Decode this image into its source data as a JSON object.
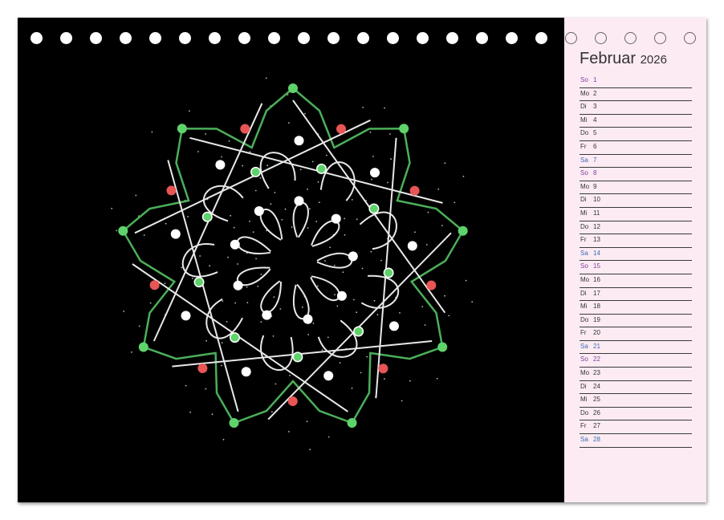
{
  "calendar": {
    "month": "Februar",
    "year": "2026",
    "days": [
      {
        "wd": "So",
        "d": "1",
        "type": "sun"
      },
      {
        "wd": "Mo",
        "d": "2",
        "type": "week"
      },
      {
        "wd": "Di",
        "d": "3",
        "type": "week"
      },
      {
        "wd": "Mi",
        "d": "4",
        "type": "week"
      },
      {
        "wd": "Do",
        "d": "5",
        "type": "week"
      },
      {
        "wd": "Fr",
        "d": "6",
        "type": "week"
      },
      {
        "wd": "Sa",
        "d": "7",
        "type": "sat"
      },
      {
        "wd": "So",
        "d": "8",
        "type": "sun"
      },
      {
        "wd": "Mo",
        "d": "9",
        "type": "week"
      },
      {
        "wd": "Di",
        "d": "10",
        "type": "week"
      },
      {
        "wd": "Mi",
        "d": "11",
        "type": "week"
      },
      {
        "wd": "Do",
        "d": "12",
        "type": "week"
      },
      {
        "wd": "Fr",
        "d": "13",
        "type": "week"
      },
      {
        "wd": "Sa",
        "d": "14",
        "type": "sat"
      },
      {
        "wd": "So",
        "d": "15",
        "type": "sun"
      },
      {
        "wd": "Mo",
        "d": "16",
        "type": "week"
      },
      {
        "wd": "Di",
        "d": "17",
        "type": "week"
      },
      {
        "wd": "Mi",
        "d": "18",
        "type": "week"
      },
      {
        "wd": "Do",
        "d": "19",
        "type": "week"
      },
      {
        "wd": "Fr",
        "d": "20",
        "type": "week"
      },
      {
        "wd": "Sa",
        "d": "21",
        "type": "sat"
      },
      {
        "wd": "So",
        "d": "22",
        "type": "sun"
      },
      {
        "wd": "Mo",
        "d": "23",
        "type": "week"
      },
      {
        "wd": "Di",
        "d": "24",
        "type": "week"
      },
      {
        "wd": "Mi",
        "d": "25",
        "type": "week"
      },
      {
        "wd": "Do",
        "d": "26",
        "type": "week"
      },
      {
        "wd": "Fr",
        "d": "27",
        "type": "week"
      },
      {
        "wd": "Sa",
        "d": "28",
        "type": "sat"
      }
    ]
  },
  "artwork": {
    "description_icon": "mandala-artwork",
    "colors": {
      "background": "#000000",
      "green_line": "#4caf5a",
      "white_line": "#e8e8e8",
      "green_dot": "#5fd36b",
      "red_dot": "#e85555",
      "white_dot": "#ffffff"
    }
  },
  "colors": {
    "panel": "#fcebf3",
    "saturday": "#3a6bb5",
    "sunday": "#7a3e9e"
  }
}
